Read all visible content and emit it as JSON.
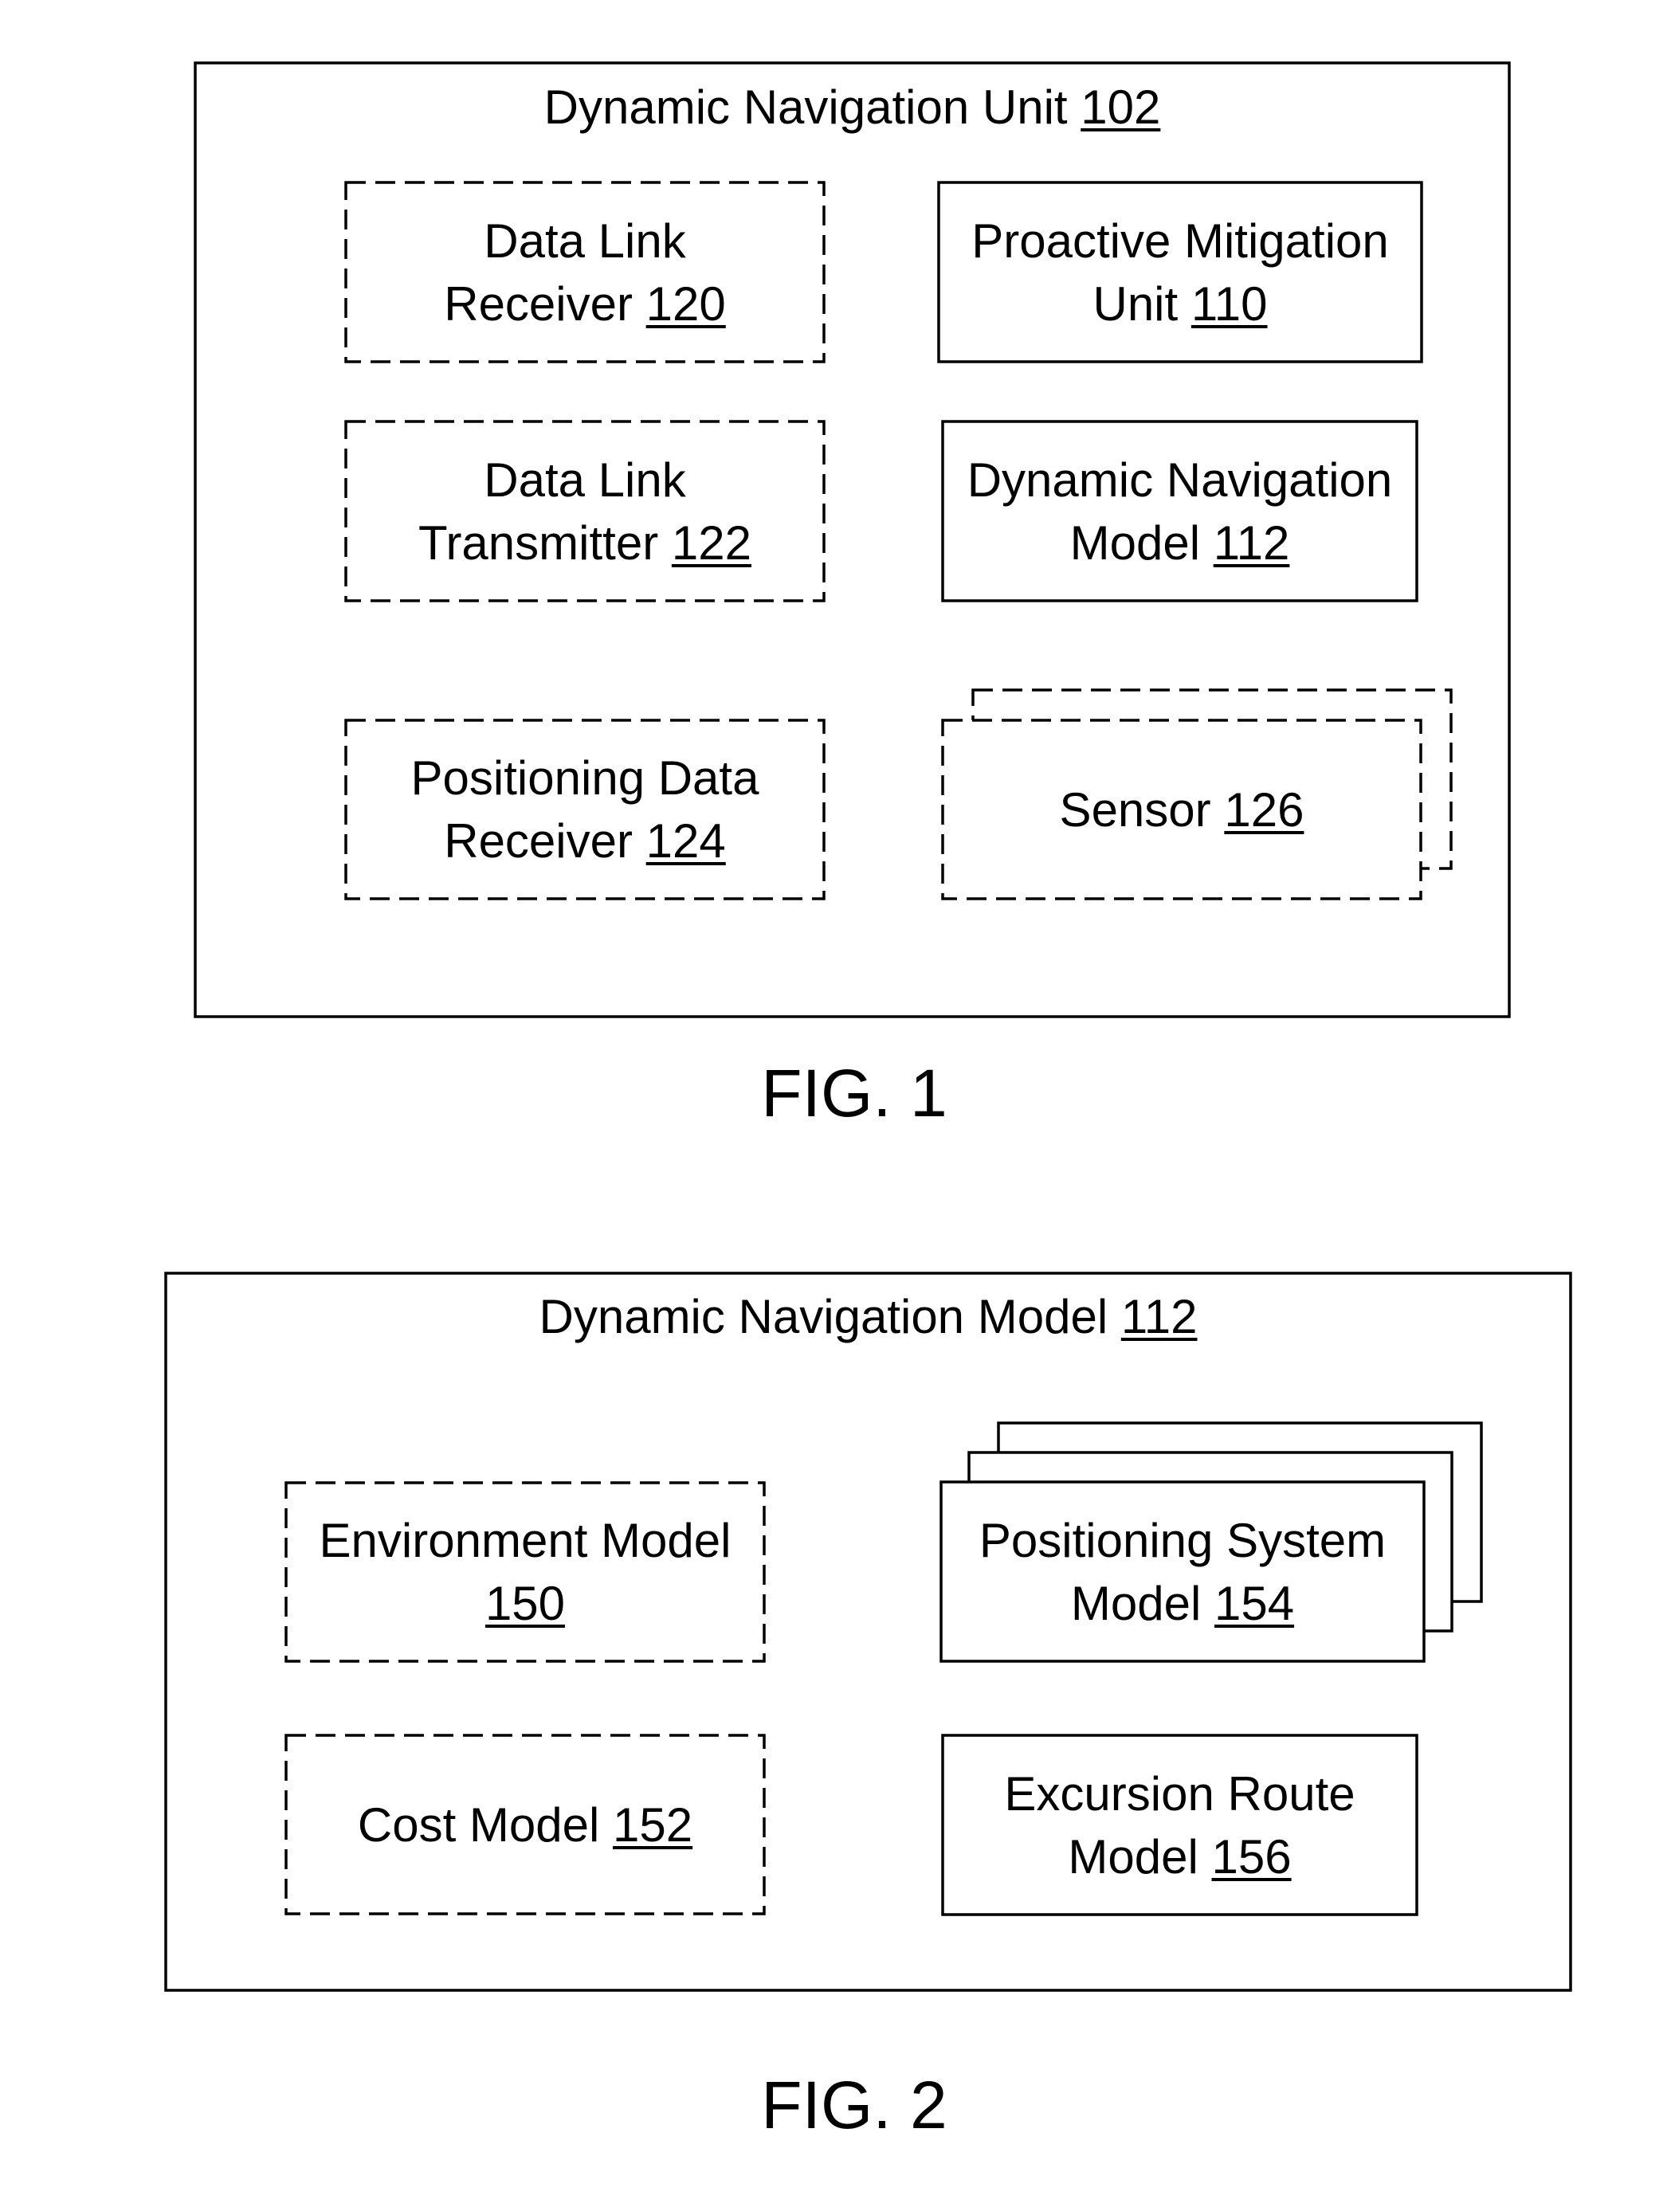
{
  "fig1": {
    "container": {
      "title": "Dynamic Navigation Unit",
      "ref": "102"
    },
    "caption": "FIG. 1",
    "blocks": [
      {
        "line1": "Data Link",
        "line2_text": "Receiver",
        "ref": "120",
        "style": "dashed"
      },
      {
        "line1": "Proactive Mitigation",
        "line2_text": "Unit",
        "ref": "110",
        "style": "solid"
      },
      {
        "line1": "Data Link",
        "line2_text": "Transmitter",
        "ref": "122",
        "style": "dashed"
      },
      {
        "line1": "Dynamic Navigation",
        "line2_text": "Model",
        "ref": "112",
        "style": "solid"
      },
      {
        "line1": "Positioning Data",
        "line2_text": "Receiver",
        "ref": "124",
        "style": "dashed"
      },
      {
        "line1": "",
        "line2_text": "Sensor",
        "ref": "126",
        "style": "dashed-stacked"
      }
    ]
  },
  "fig2": {
    "container": {
      "title": "Dynamic Navigation Model",
      "ref": "112"
    },
    "caption": "FIG. 2",
    "blocks": [
      {
        "line1": "Environment Model",
        "line2_text": "",
        "ref": "150",
        "style": "dashed"
      },
      {
        "line1": "Positioning System",
        "line2_text": "Model",
        "ref": "154",
        "style": "solid-stacked"
      },
      {
        "line1": "",
        "line2_text": "Cost Model",
        "ref": "152",
        "style": "dashed"
      },
      {
        "line1": "Excursion Route",
        "line2_text": "Model",
        "ref": "156",
        "style": "solid"
      }
    ]
  }
}
